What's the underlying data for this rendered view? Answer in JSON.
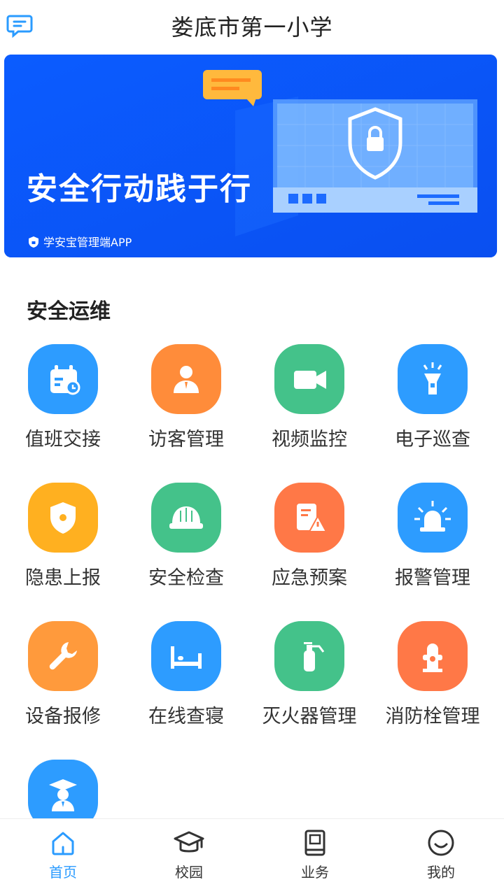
{
  "header": {
    "title": "娄底市第一小学",
    "message_icon": "message-icon"
  },
  "banner": {
    "slogan": "安全行动践于行",
    "subtitle": "学安宝管理端APP",
    "icons": [
      "chat-bubble-icon",
      "shield-lock-icon"
    ]
  },
  "section": {
    "title": "安全运维"
  },
  "tiles": [
    {
      "label": "值班交接",
      "icon": "calendar-clock-icon",
      "color": "#2d9cff"
    },
    {
      "label": "访客管理",
      "icon": "visitor-icon",
      "color": "#ff8c3a"
    },
    {
      "label": "视频监控",
      "icon": "video-camera-icon",
      "color": "#44c28a"
    },
    {
      "label": "电子巡查",
      "icon": "flashlight-icon",
      "color": "#2d9cff"
    },
    {
      "label": "隐患上报",
      "icon": "shield-alert-icon",
      "color": "#ffb020"
    },
    {
      "label": "安全检查",
      "icon": "hard-hat-icon",
      "color": "#44c28a"
    },
    {
      "label": "应急预案",
      "icon": "document-warning-icon",
      "color": "#ff7847"
    },
    {
      "label": "报警管理",
      "icon": "siren-icon",
      "color": "#2d9cff"
    },
    {
      "label": "设备报修",
      "icon": "wrench-icon",
      "color": "#ff9a3c"
    },
    {
      "label": "在线查寝",
      "icon": "bed-icon",
      "color": "#2d9cff"
    },
    {
      "label": "灭火器管理",
      "icon": "fire-extinguisher-icon",
      "color": "#44c28a"
    },
    {
      "label": "消防栓管理",
      "icon": "fire-hydrant-icon",
      "color": "#ff7847"
    },
    {
      "label": "",
      "icon": "graduate-icon",
      "color": "#2d9cff"
    }
  ],
  "nav": [
    {
      "label": "首页",
      "icon": "home-icon",
      "active": true
    },
    {
      "label": "校园",
      "icon": "graduation-cap-icon",
      "active": false
    },
    {
      "label": "业务",
      "icon": "book-icon",
      "active": false
    },
    {
      "label": "我的",
      "icon": "smile-icon",
      "active": false
    }
  ],
  "colors": {
    "accent": "#2a9bff",
    "banner": "#0b5cff"
  }
}
